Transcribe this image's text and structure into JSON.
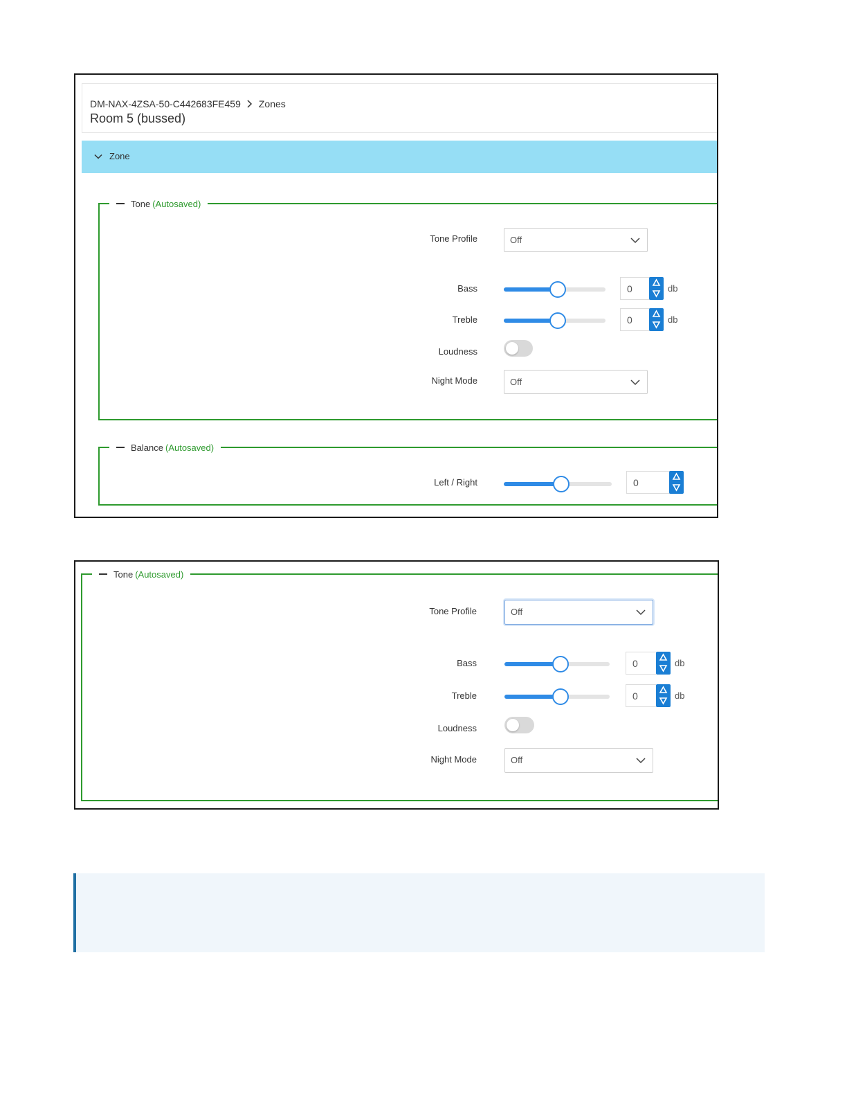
{
  "screenshot1": {
    "breadcrumb": {
      "device": "DM-NAX-4ZSA-50-C442683FE459",
      "section": "Zones"
    },
    "page_title": "Room 5 (bussed)",
    "zone_section_label": "Zone",
    "tone_group": {
      "legend": "Tone",
      "legend_status": "(Autosaved)",
      "tone_profile": {
        "label": "Tone Profile",
        "value": "Off"
      },
      "bass": {
        "label": "Bass",
        "value": "0",
        "unit": "db",
        "slider_fraction": 0.53
      },
      "treble": {
        "label": "Treble",
        "value": "0",
        "unit": "db",
        "slider_fraction": 0.53
      },
      "loudness": {
        "label": "Loudness",
        "on": false
      },
      "night_mode": {
        "label": "Night Mode",
        "value": "Off"
      }
    },
    "balance_group": {
      "legend": "Balance",
      "legend_status": "(Autosaved)",
      "left_right": {
        "label": "Left / Right",
        "value": "0",
        "slider_fraction": 0.53
      }
    }
  },
  "screenshot2": {
    "tone_group": {
      "legend": "Tone",
      "legend_status": "(Autosaved)",
      "tone_profile": {
        "label": "Tone Profile",
        "value": "Off"
      },
      "bass": {
        "label": "Bass",
        "value": "0",
        "unit": "db",
        "slider_fraction": 0.53
      },
      "treble": {
        "label": "Treble",
        "value": "0",
        "unit": "db",
        "slider_fraction": 0.53
      },
      "loudness": {
        "label": "Loudness",
        "on": false
      },
      "night_mode": {
        "label": "Night Mode",
        "value": "Off"
      }
    }
  },
  "colors": {
    "accent": "#2f8be6",
    "group_border": "#2e9a2e",
    "zone_bar": "#96def5",
    "note_bg": "#f0f6fb"
  }
}
